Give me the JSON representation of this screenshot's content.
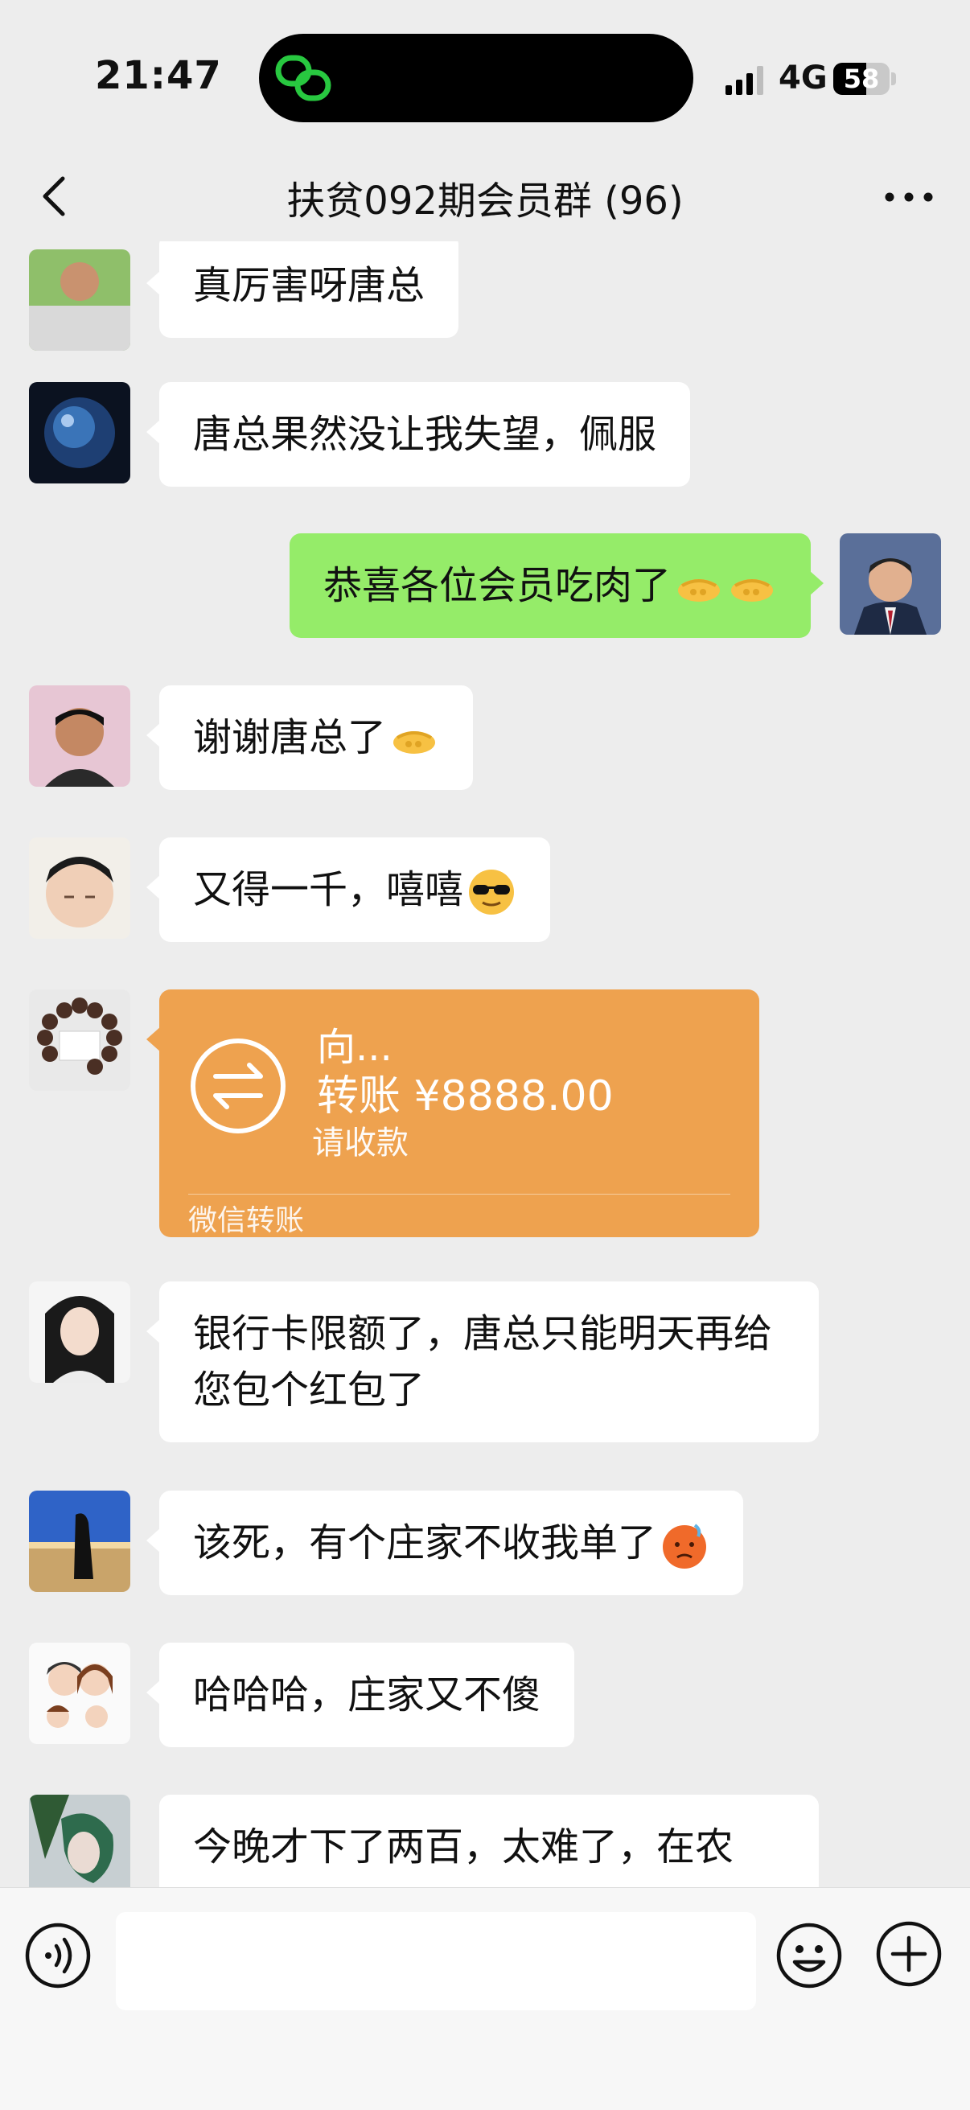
{
  "status_bar": {
    "time": "21:47",
    "network": "4G",
    "battery": "58",
    "battery_level_percent": 58
  },
  "nav": {
    "title": "扶贫092期会员群 (96)"
  },
  "messages": [
    {
      "side": "left",
      "text": "真厉害呀唐总"
    },
    {
      "side": "left",
      "text": "唐总果然没让我失望，佩服"
    },
    {
      "side": "right",
      "text": "恭喜各位会员吃肉了",
      "emoji": [
        "handshake-emoji",
        "handshake-emoji"
      ]
    },
    {
      "side": "left",
      "text": "谢谢唐总了",
      "emoji": [
        "handshake-emoji"
      ]
    },
    {
      "side": "left",
      "text": "又得一千，嘻嘻",
      "emoji": [
        "sunglasses-emoji"
      ]
    },
    {
      "side": "left",
      "type": "transfer",
      "to": "向...",
      "amount": "转账 ¥8888.00",
      "status": "请收款",
      "brand": "微信转账"
    },
    {
      "side": "left",
      "text": "银行卡限额了，唐总只能明天再给您包个红包了"
    },
    {
      "side": "left",
      "text": "该死，有个庄家不收我单了",
      "emoji": [
        "steaming-angry-emoji"
      ]
    },
    {
      "side": "left",
      "text": "哈哈哈，庄家又不傻"
    },
    {
      "side": "left",
      "text": "今晚才下了两百，太难了，在农"
    }
  ],
  "colors": {
    "background": "#ededed",
    "bubble_self": "#95ec69",
    "bubble_other": "#ffffff",
    "transfer": "#eea24f"
  }
}
